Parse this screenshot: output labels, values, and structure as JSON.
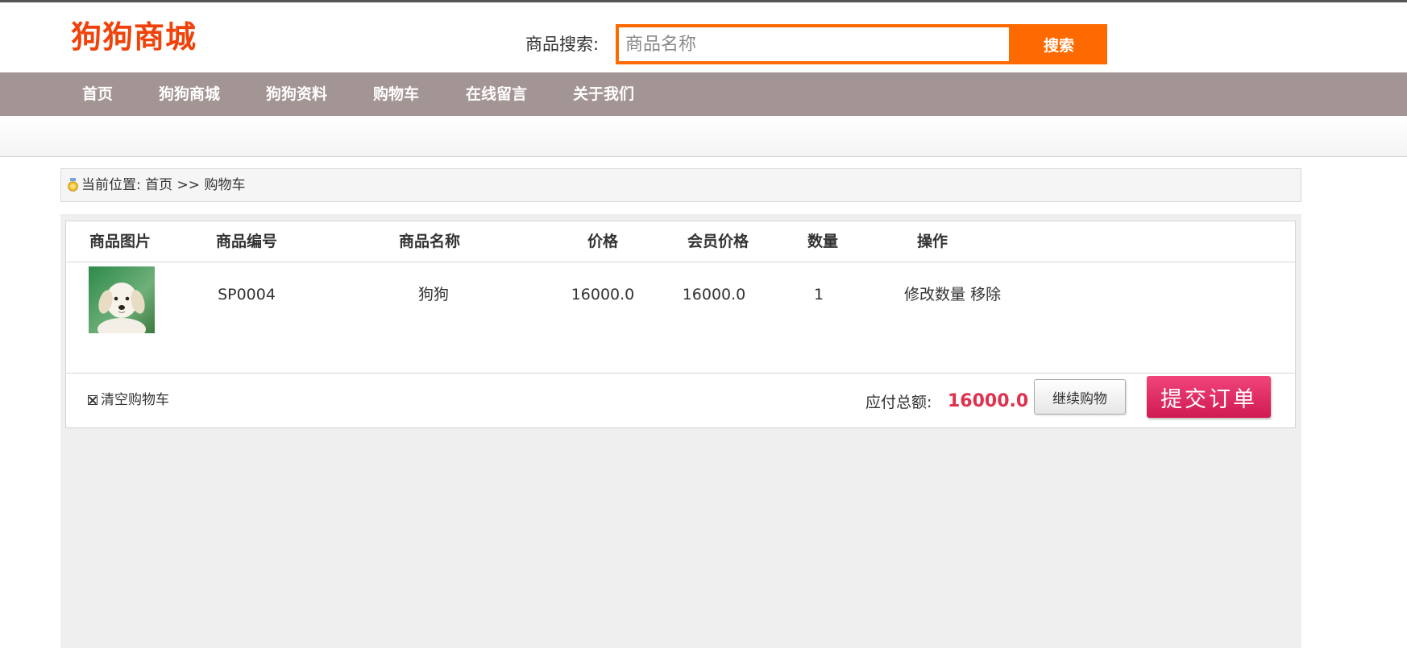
{
  "header": {
    "logo": "狗狗商城",
    "search": {
      "label": "商品搜索:",
      "placeholder": "商品名称",
      "value": "",
      "button_label": "搜索"
    }
  },
  "nav": {
    "items": [
      {
        "label": "首页"
      },
      {
        "label": "狗狗商城"
      },
      {
        "label": "狗狗资料"
      },
      {
        "label": "购物车"
      },
      {
        "label": "在线留言"
      },
      {
        "label": "关于我们"
      }
    ]
  },
  "breadcrumb": {
    "prefix": "当前位置:",
    "home": "首页",
    "separator": ">>",
    "current": "购物车",
    "icon": "medal-icon"
  },
  "cart": {
    "columns": [
      "商品图片",
      "商品编号",
      "商品名称",
      "价格",
      "会员价格",
      "数量",
      "操作"
    ],
    "items": [
      {
        "image": "puppy-thumbnail",
        "code": "SP0004",
        "name": "狗狗",
        "price": "16000.0",
        "member_price": "16000.0",
        "quantity": "1",
        "actions": {
          "edit": "修改数量",
          "remove": "移除"
        }
      }
    ],
    "clear_label": "清空购物车",
    "total_label": "应付总额:",
    "total_value": "16000.0",
    "continue_label": "继续购物",
    "submit_label": "提交订单"
  },
  "colors": {
    "brand_orange": "#ff6a00",
    "logo_red": "#f0420a",
    "nav_bg": "#a39593",
    "total_red": "#e0314e",
    "submit_pink": "#d01a52"
  }
}
